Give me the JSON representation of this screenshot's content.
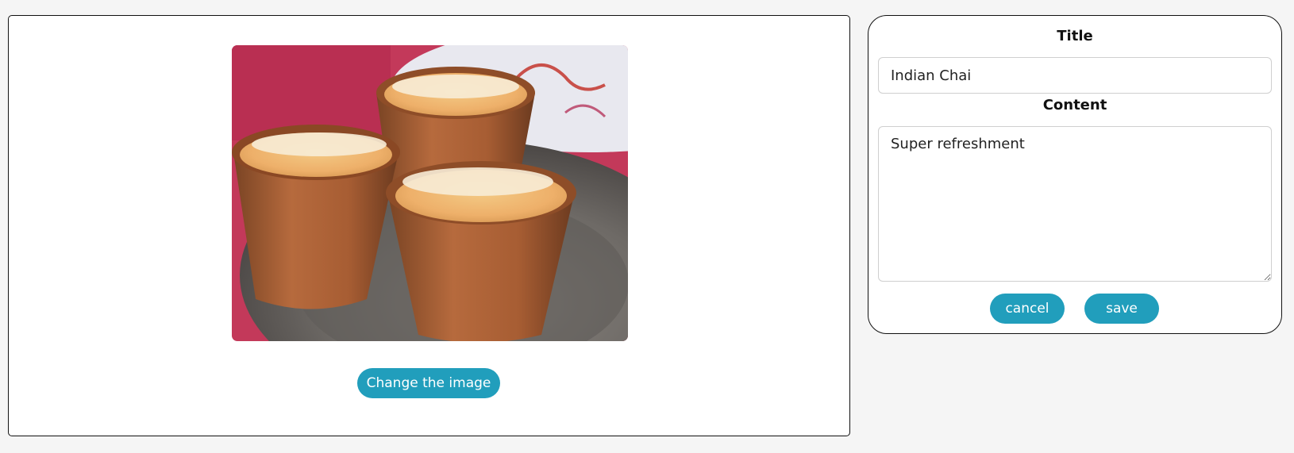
{
  "image_panel": {
    "change_button_label": "Change the image"
  },
  "form": {
    "title_label": "Title",
    "title_value": "Indian Chai",
    "content_label": "Content",
    "content_value": "Super refreshment",
    "cancel_label": "cancel",
    "save_label": "save"
  },
  "colors": {
    "button": "#219ebc",
    "page_background": "#f5f5f5"
  }
}
